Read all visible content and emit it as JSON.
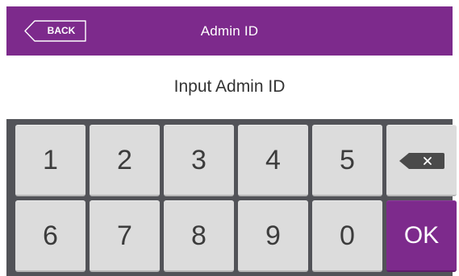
{
  "header": {
    "title": "Admin ID",
    "back_label": "BACK"
  },
  "prompt": "Input Admin ID",
  "keypad": {
    "row1": [
      "1",
      "2",
      "3",
      "4",
      "5"
    ],
    "row2": [
      "6",
      "7",
      "8",
      "9",
      "0"
    ],
    "ok_label": "OK",
    "backspace_icon": "backspace-icon"
  },
  "colors": {
    "accent": "#7d2a8c",
    "keypad_bg": "#525358",
    "key_bg": "#dcdcdc"
  }
}
